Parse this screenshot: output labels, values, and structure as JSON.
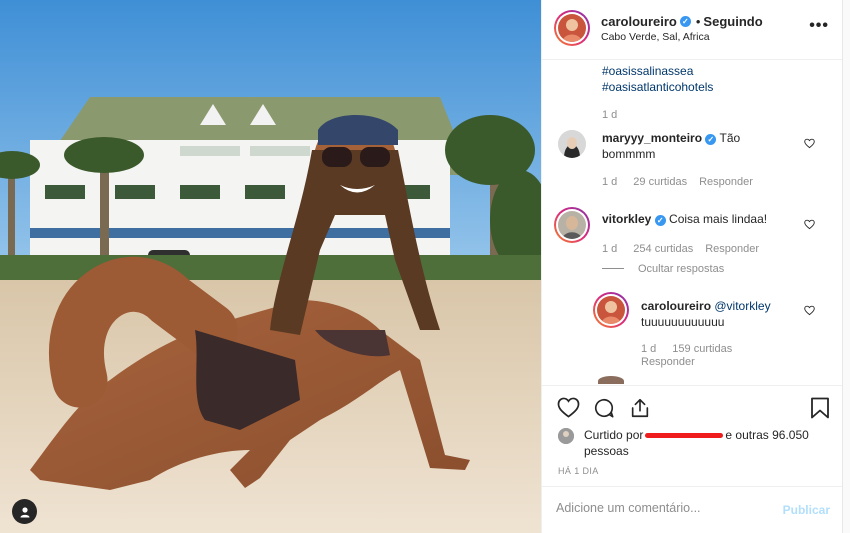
{
  "post": {
    "username": "caroloureiro",
    "separator": "•",
    "follow_status": "Seguindo",
    "location": "Cabo Verde, Sal, Africa",
    "more_icon": "more-horizontal-icon"
  },
  "caption": {
    "hashtags": [
      "#oasissalinassea",
      "#oasisatlanticohotels"
    ],
    "age": "1 d"
  },
  "comments": [
    {
      "user": "maryyy_monteiro",
      "text": "Tão bommmm",
      "age": "1 d",
      "likes": "29 curtidas",
      "reply": "Responder"
    },
    {
      "user": "vitorkley",
      "text": "Coisa mais lindaa!",
      "age": "1 d",
      "likes": "254 curtidas",
      "reply": "Responder",
      "hide_replies": "Ocultar respostas"
    }
  ],
  "reply": {
    "user": "caroloureiro",
    "mention": "@vitorkley",
    "text": "tuuuuuuuuuuuu",
    "age": "1 d",
    "likes": "159 curtidas",
    "reply": "Responder"
  },
  "likes": {
    "prefix": "Curtido por",
    "suffix": "e",
    "others": "outras 96.050 pessoas"
  },
  "timestamp": "HÁ 1 DIA",
  "add_comment": {
    "placeholder": "Adicione um comentário...",
    "publish": "Publicar"
  },
  "colors": {
    "verified": "#3897f0",
    "hashtag": "#00376b",
    "publish_disabled": "#b2dffc",
    "redaction": "#ee1c1c"
  }
}
